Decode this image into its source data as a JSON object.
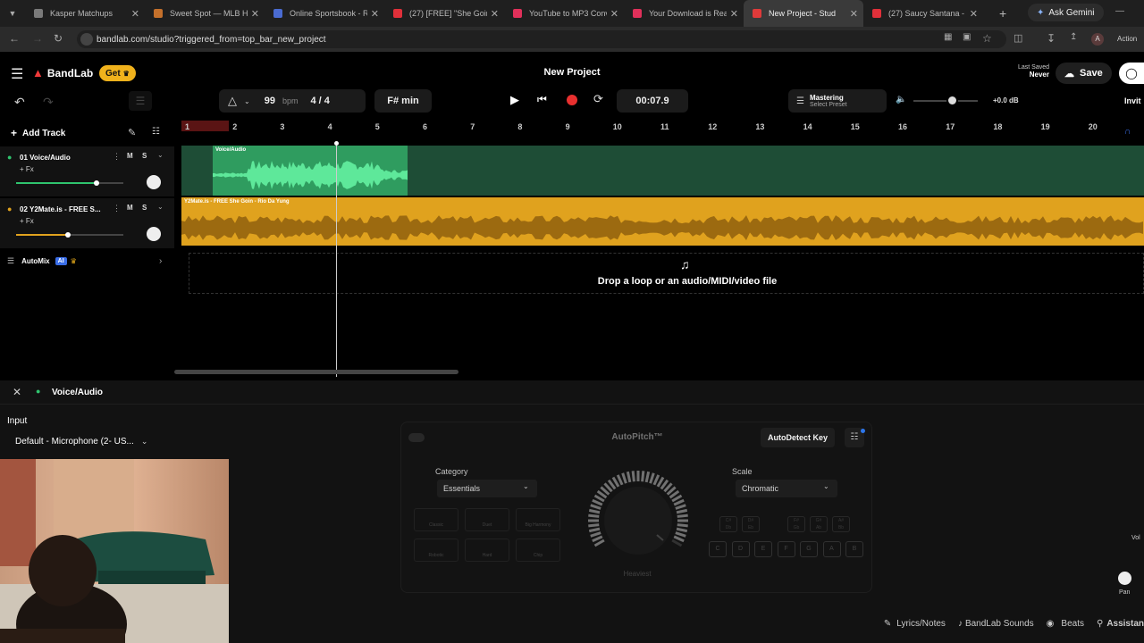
{
  "browser": {
    "tabs": [
      {
        "title": "Kasper Matchups",
        "color": "#7a7a7a"
      },
      {
        "title": "Sweet Spot — MLB Hi",
        "color": "#c4702b"
      },
      {
        "title": "Online Sportsbook - R",
        "color": "#4a6bd1"
      },
      {
        "title": "(27) [FREE] \"She Goin'",
        "color": "#e0303a"
      },
      {
        "title": "YouTube to MP3 Conv",
        "color": "#e0305a"
      },
      {
        "title": "Your Download is Rea",
        "color": "#e0305a"
      },
      {
        "title": "New Project - Stud",
        "color": "#e03a3a",
        "active": true
      },
      {
        "title": "(27) Saucy Santana - (",
        "color": "#e0303a"
      }
    ],
    "new_tab": "+",
    "gemini": "Ask Gemini",
    "url": "bandlab.com/studio?triggered_from=top_bar_new_project",
    "profile": "A",
    "action": "Action"
  },
  "app": {
    "brand": "BandLab",
    "get_label": "Get",
    "project_title": "New Project",
    "last_saved_label": "Last Saved",
    "last_saved_value": "Never",
    "save_label": "Save",
    "invite_label": "Invit",
    "tempo": "99",
    "bpm_label": "bpm",
    "time_sig": "4 / 4",
    "key": "F# min",
    "time": "00:07.9",
    "mastering_title": "Mastering",
    "mastering_sub": "Select Preset",
    "volume_db": "+0.0 dB",
    "volume_level": 0.6,
    "add_track": "Add Track",
    "automix": "AutoMix",
    "ai_badge": "AI",
    "drop_text": "Drop a loop or an audio/MIDI/video file"
  },
  "ruler": [
    "1",
    "2",
    "3",
    "4",
    "5",
    "6",
    "7",
    "8",
    "9",
    "10",
    "11",
    "12",
    "13",
    "14",
    "15",
    "16",
    "17",
    "18",
    "19",
    "20"
  ],
  "tracks": [
    {
      "name": "01  Voice/Audio",
      "fx": "+ Fx",
      "m": "M",
      "s": "S",
      "clip": "Voice/Audio",
      "color": "#2f9c5f",
      "volume": 0.75
    },
    {
      "name": "02  Y2Mate.is - FREE S...",
      "fx": "+ Fx",
      "m": "M",
      "s": "S",
      "clip": "Y2Mate.is - FREE She Goin - Rio Da Yung",
      "color": "#e0a21e",
      "volume": 0.48
    }
  ],
  "panel": {
    "track_name": "Voice/Audio",
    "input_label": "Input",
    "input_value": "Default - Microphone (2- US...",
    "autopitch_title": "AutoPitch™",
    "autodetect": "AutoDetect Key",
    "category_label": "Category",
    "category_value": "Essentials",
    "scale_label": "Scale",
    "scale_value": "Chromatic",
    "dial_label": "Heaviest",
    "effects_row1": [
      "Classic",
      "Duet",
      "Big Harmony"
    ],
    "effects_row2": [
      "Robotic",
      "Hard",
      "Chip"
    ],
    "sharps": [
      "C#\nDb",
      "D#\nEb",
      "F#\nGb",
      "G#\nAb",
      "A#\nBb"
    ],
    "naturals": [
      "C",
      "D",
      "E",
      "F",
      "G",
      "A",
      "B"
    ],
    "vol_label": "Vol",
    "pan_label": "Pan"
  },
  "bottom": {
    "lyrics": "Lyrics/Notes",
    "sounds": "BandLab Sounds",
    "beats": "Beats",
    "assistant": "Assistan"
  }
}
